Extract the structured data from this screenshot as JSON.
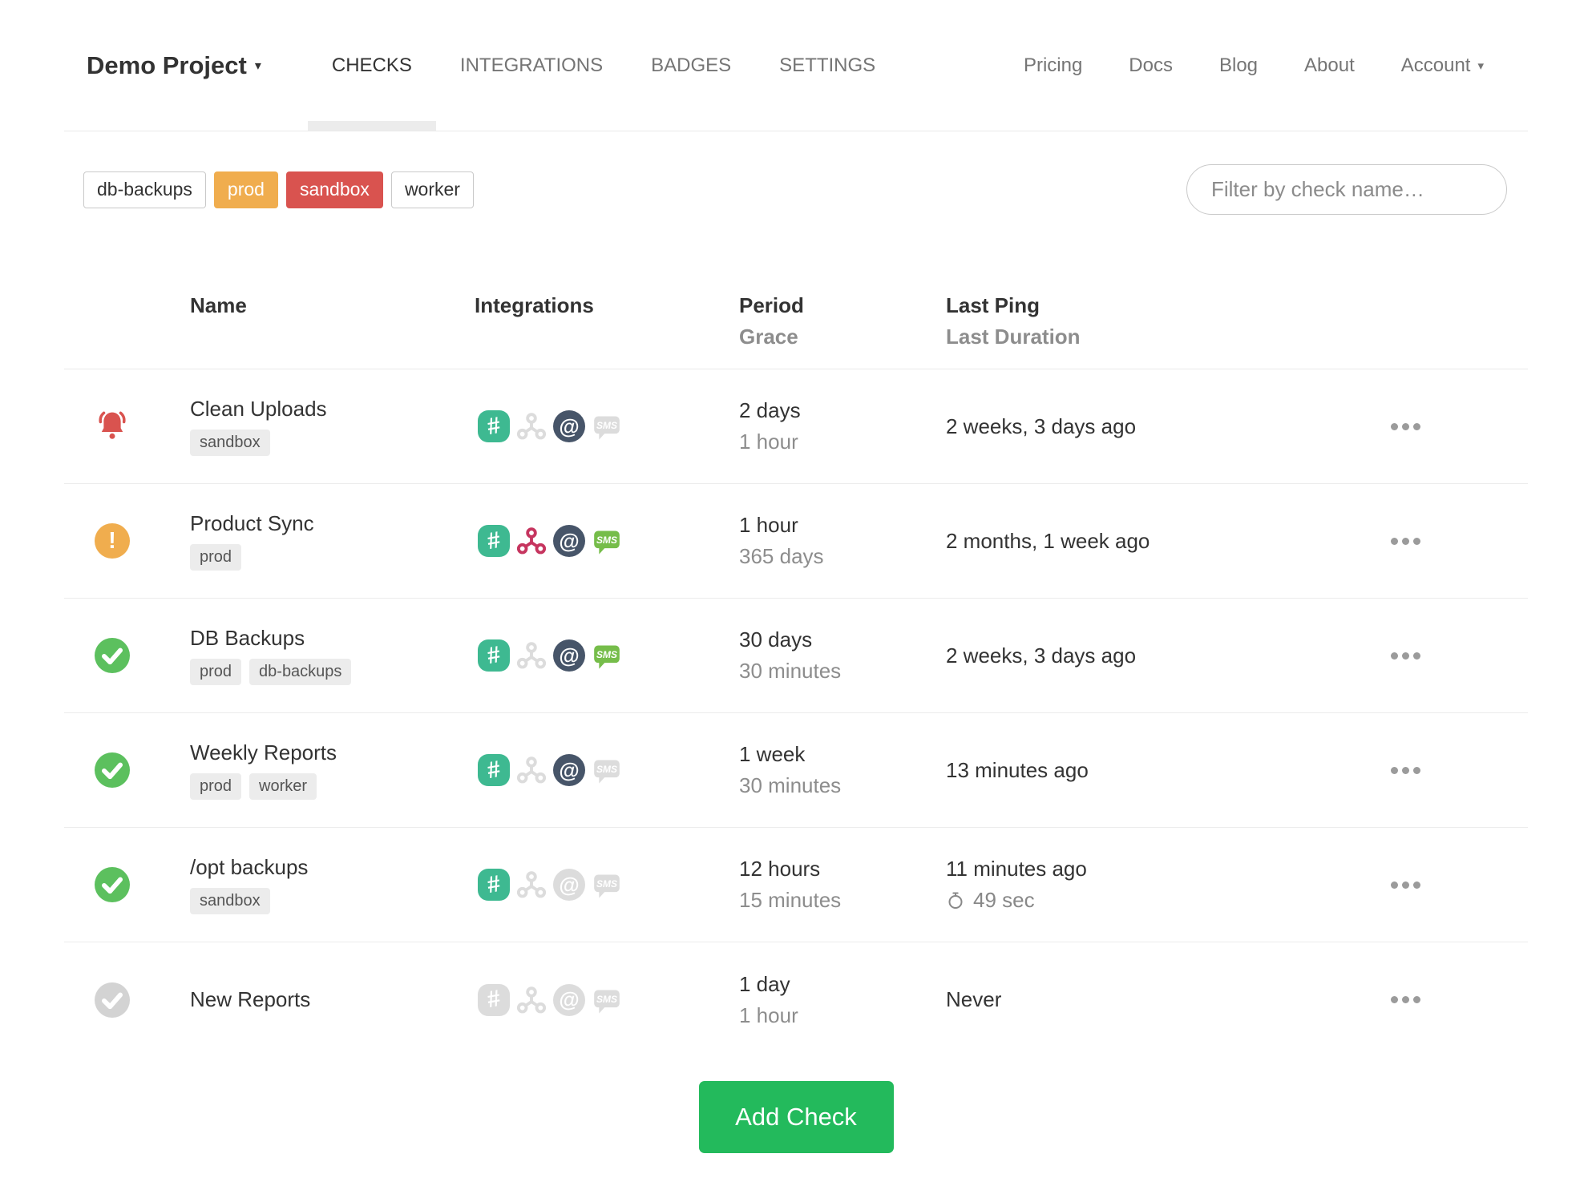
{
  "nav": {
    "project_name": "Demo Project",
    "tabs": [
      "CHECKS",
      "INTEGRATIONS",
      "BADGES",
      "SETTINGS"
    ],
    "active_tab": "CHECKS",
    "links": [
      "Pricing",
      "Docs",
      "Blog",
      "About"
    ],
    "account_label": "Account"
  },
  "filters": {
    "tags": [
      {
        "label": "db-backups",
        "variant": "outline"
      },
      {
        "label": "prod",
        "variant": "warning"
      },
      {
        "label": "sandbox",
        "variant": "danger"
      },
      {
        "label": "worker",
        "variant": "outline"
      }
    ],
    "search_placeholder": "Filter by check name…"
  },
  "table": {
    "headers": {
      "name": "Name",
      "integrations": "Integrations",
      "period": "Period",
      "grace": "Grace",
      "last_ping": "Last Ping",
      "last_duration": "Last Duration"
    },
    "rows": [
      {
        "name": "Clean Uploads",
        "status": "alert",
        "tags": [
          "sandbox"
        ],
        "integrations": {
          "slack": true,
          "webhook": false,
          "email": true,
          "sms": false
        },
        "period": "2 days",
        "grace": "1 hour",
        "last_ping": "2 weeks, 3 days ago"
      },
      {
        "name": "Product Sync",
        "status": "grace",
        "tags": [
          "prod"
        ],
        "integrations": {
          "slack": true,
          "webhook": true,
          "email": true,
          "sms": true
        },
        "period": "1 hour",
        "grace": "365 days",
        "last_ping": "2 months, 1 week ago"
      },
      {
        "name": "DB Backups",
        "status": "up",
        "tags": [
          "prod",
          "db-backups"
        ],
        "integrations": {
          "slack": true,
          "webhook": false,
          "email": true,
          "sms": true
        },
        "period": "30 days",
        "grace": "30 minutes",
        "last_ping": "2 weeks, 3 days ago"
      },
      {
        "name": "Weekly Reports",
        "status": "up",
        "tags": [
          "prod",
          "worker"
        ],
        "integrations": {
          "slack": true,
          "webhook": false,
          "email": true,
          "sms": false
        },
        "period": "1 week",
        "grace": "30 minutes",
        "last_ping": "13 minutes ago"
      },
      {
        "name": "/opt backups",
        "status": "up",
        "tags": [
          "sandbox"
        ],
        "integrations": {
          "slack": true,
          "webhook": false,
          "email": false,
          "sms": false
        },
        "period": "12 hours",
        "grace": "15 minutes",
        "last_ping": "11 minutes ago",
        "last_duration": "49 sec"
      },
      {
        "name": "New Reports",
        "status": "new",
        "tags": [],
        "integrations": {
          "slack": false,
          "webhook": false,
          "email": false,
          "sms": false
        },
        "period": "1 day",
        "grace": "1 hour",
        "last_ping": "Never"
      }
    ]
  },
  "add_check_label": "Add Check",
  "colors": {
    "status_alert": "#d9534f",
    "status_grace": "#f0ad4e",
    "status_up": "#5cc05e",
    "status_new": "#d3d3d3",
    "tag_warning": "#f0ad4e",
    "tag_danger": "#d9534f",
    "slack_on": "#3eb991",
    "webhook_on": "#c6355f",
    "email_on": "#475569",
    "sms_on": "#76bd4a",
    "integration_off": "#dcdcdc",
    "add_button": "#23ba5c"
  }
}
